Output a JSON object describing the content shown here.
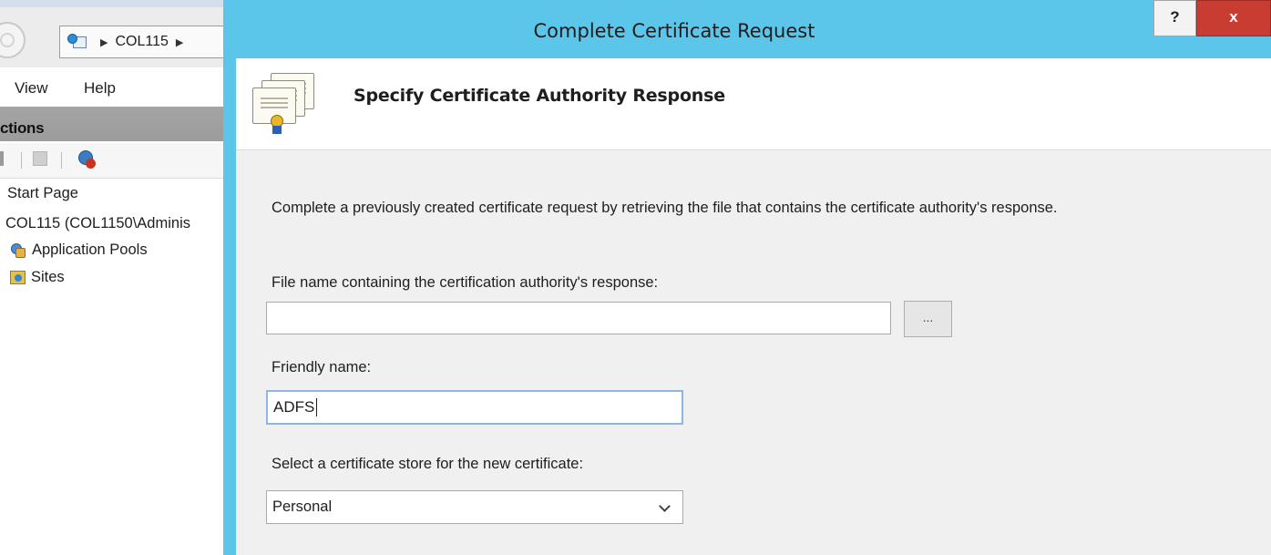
{
  "background_window": {
    "breadcrumb": [
      "COL115"
    ],
    "menu": {
      "view": "View",
      "help": "Help"
    },
    "actions_header": "ctions",
    "tree": {
      "start_page": "Start Page",
      "server_node": "COL115 (COL1150\\Adminis",
      "application_pools": "Application Pools",
      "sites": "Sites"
    }
  },
  "dialog": {
    "title": "Complete Certificate Request",
    "help_label": "?",
    "close_label": "x",
    "header_title": "Specify Certificate Authority Response",
    "description": "Complete a previously created certificate request by retrieving the file that contains the certificate authority's response.",
    "file_label": "File name containing the certification authority's response:",
    "file_value": "",
    "browse_label": "...",
    "friendly_label": "Friendly name:",
    "friendly_value": "ADFS",
    "store_label": "Select a certificate store for the new certificate:",
    "store_selected": "Personal"
  },
  "colors": {
    "dialog_frame": "#5bc6e9",
    "close_button": "#c83c32",
    "actions_header": "#a0a0a0",
    "input_focus_border": "#8fb6e3"
  },
  "icons": [
    "back-icon",
    "iis-connection-icon",
    "connect-icon",
    "application-pools-icon",
    "sites-icon",
    "certificate-icon",
    "chevron-down-icon"
  ]
}
